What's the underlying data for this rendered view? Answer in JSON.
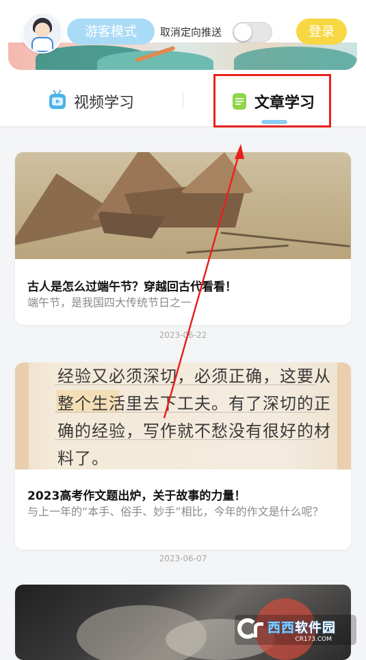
{
  "header": {
    "guest_mode_label": "游客模式",
    "cancel_targeted_push_label": "取消定向推送",
    "targeted_push_toggle": "off",
    "login_label": "登录"
  },
  "tabs": [
    {
      "label": "视频学习",
      "icon": "tv-icon",
      "active": false
    },
    {
      "label": "文章学习",
      "icon": "document-icon",
      "active": true
    }
  ],
  "articles": [
    {
      "title": "古人是怎么过端午节？穿越回古代看看！",
      "description": "端午节，是我国四大传统节日之一",
      "date": "2023-06-22"
    },
    {
      "title": "2023高考作文题出炉，关于故事的力量！",
      "description": "与上一年的“本手、俗手、妙手”相比，今年的作文是什么呢？",
      "date": "2023-06-07",
      "thumbnail_text": [
        "经验又必须深切，必须正确，这要从",
        "整个生活里去下工夫。有了深切的正",
        "确的经验，写作就不愁没有很好的材",
        "料了。"
      ]
    },
    {
      "title": "",
      "description": "",
      "date": ""
    }
  ],
  "watermark": {
    "logo_text": "Cr",
    "brand_a": "西西",
    "brand_b": "软件园",
    "sub": "CR173.COM"
  },
  "colors": {
    "guest_button": "#a9dbf7",
    "login_button": "#f7d743",
    "tab_indicator": "#8ccbf2",
    "annotation_red": "#e8211c"
  }
}
